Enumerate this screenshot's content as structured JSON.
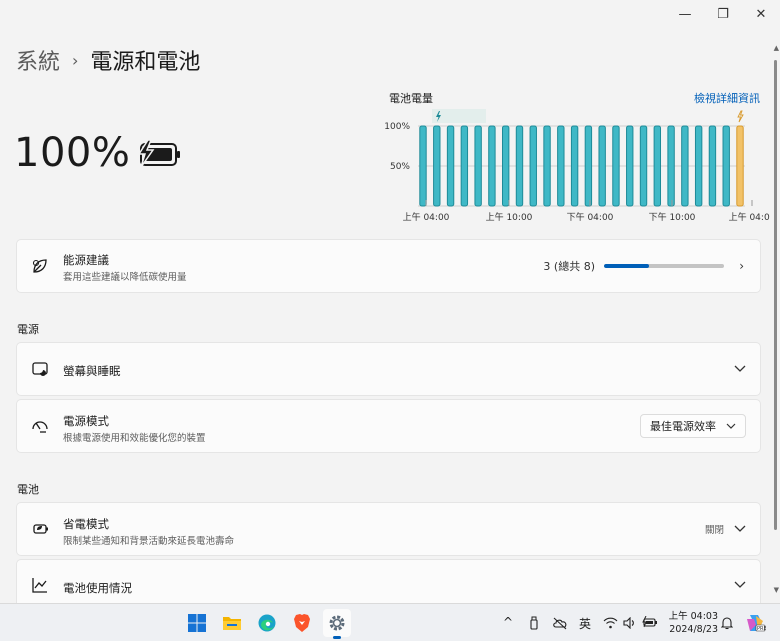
{
  "window": {
    "minimize": "—",
    "restore": "❐",
    "close": "✕"
  },
  "breadcrumb": {
    "parent": "系統",
    "separator": "›",
    "current": "電源和電池"
  },
  "battery": {
    "percent": "100%",
    "level": 1.0
  },
  "chart_data": {
    "type": "bar",
    "title": "電池電量",
    "link": "檢視詳細資訊",
    "y_ticks": [
      "100%",
      "50%"
    ],
    "ylim": [
      0,
      100
    ],
    "x_ticks": [
      "上午 04:00",
      "上午 10:00",
      "下午 04:00",
      "下午 10:00",
      "上午 04:00"
    ],
    "values": [
      100,
      100,
      100,
      100,
      100,
      100,
      100,
      100,
      100,
      100,
      100,
      100,
      100,
      100,
      100,
      100,
      100,
      100,
      100,
      100,
      100,
      100,
      100,
      100
    ],
    "colors": {
      "charging": "#3fb8c6",
      "charging_border": "#1e8b98",
      "on_battery": "#f2c268",
      "on_battery_border": "#d89a2d"
    }
  },
  "cards": {
    "energy": {
      "title": "能源建議",
      "subtitle": "套用這些建議以降低碳使用量",
      "count": "3 (總共 8)",
      "progress": 0.375
    },
    "power_section": "電源",
    "screen_sleep": {
      "title": "螢幕與睡眠"
    },
    "power_mode": {
      "title": "電源模式",
      "subtitle": "根據電源使用和效能優化您的裝置",
      "value": "最佳電源效率"
    },
    "battery_section": "電池",
    "battery_saver": {
      "title": "省電模式",
      "subtitle": "限制某些通知和背景活動來延長電池壽命",
      "state": "關閉"
    },
    "battery_usage": {
      "title": "電池使用情況"
    }
  },
  "taskbar": {
    "apps": [
      "windows-start",
      "file-explorer",
      "edge",
      "brave",
      "settings"
    ],
    "tray": {
      "chevron": "^",
      "ime": "英",
      "time": "上午 04:03",
      "date": "2024/8/23"
    }
  },
  "accent": "#005fb8"
}
